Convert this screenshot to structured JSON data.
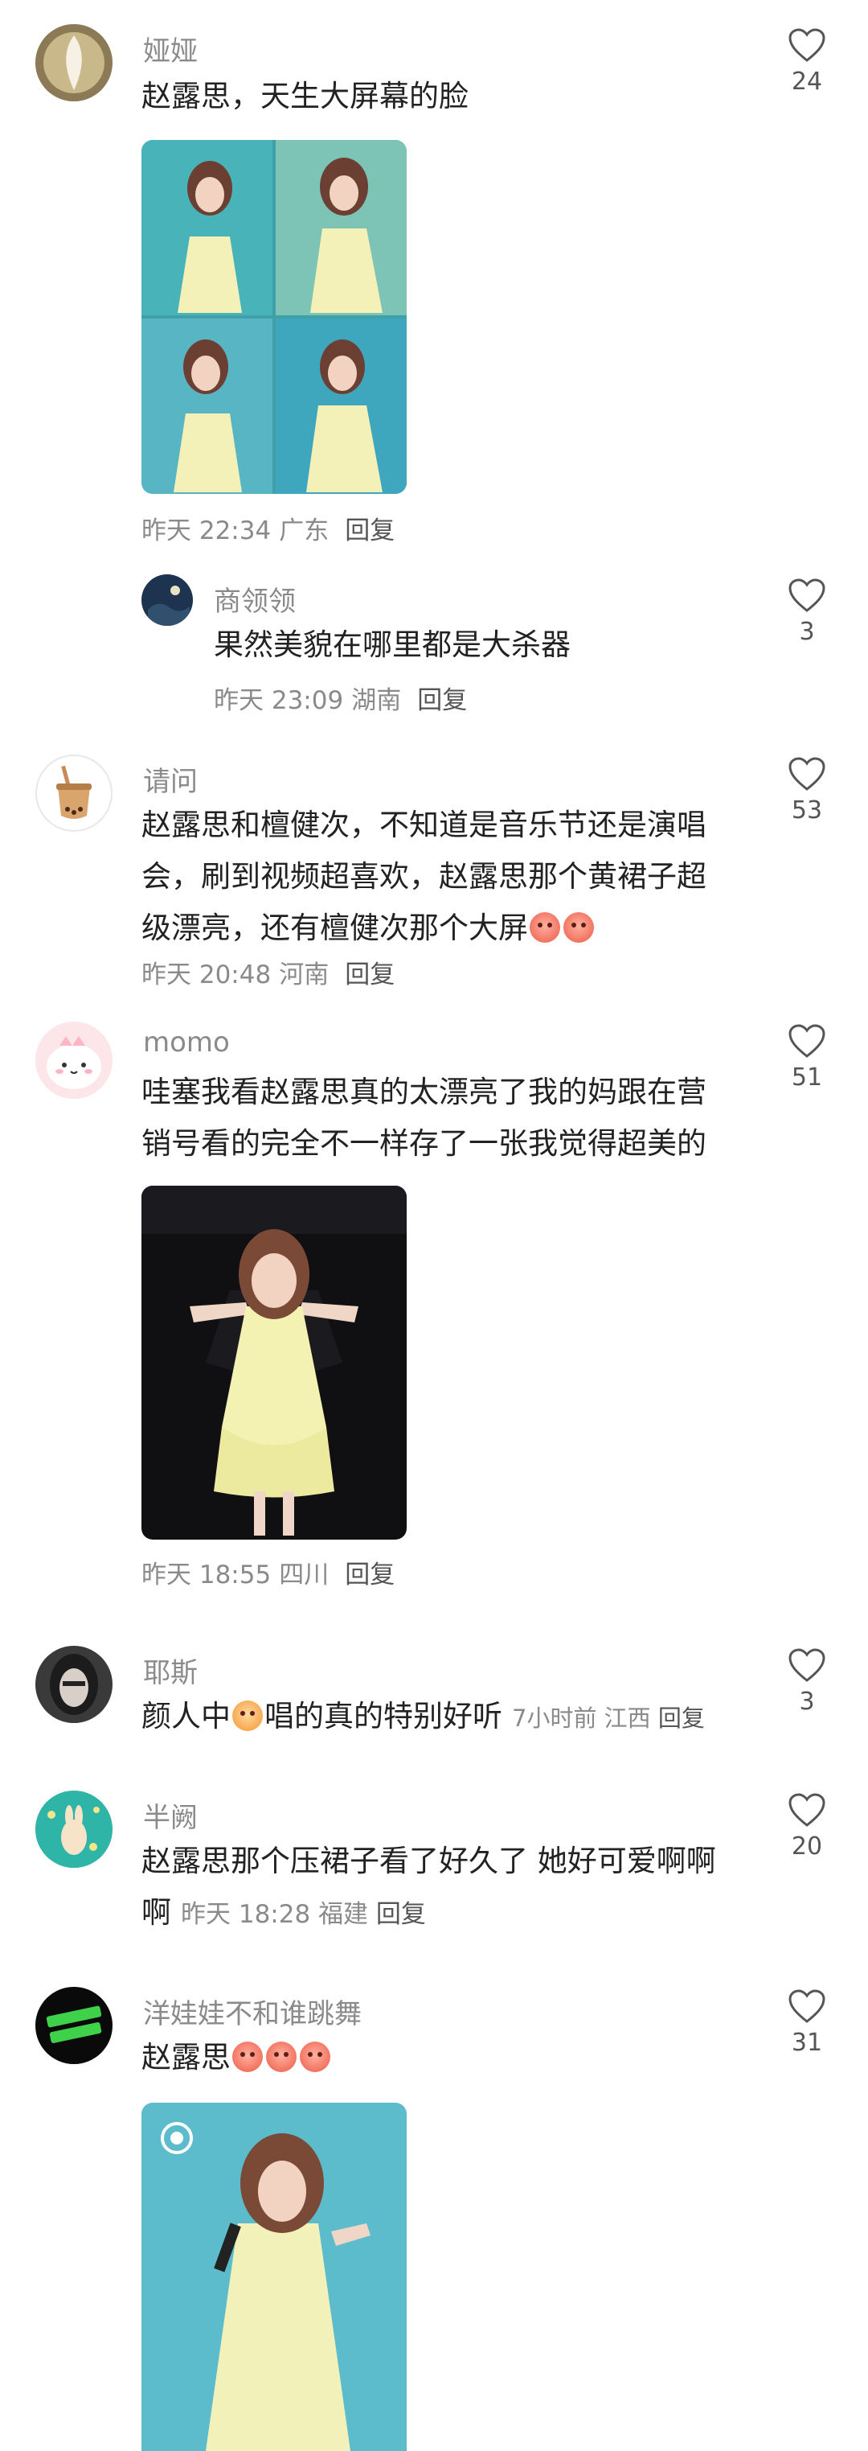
{
  "comments": [
    {
      "username": "娅娅",
      "text": "赵露思，天生大屏幕的脸",
      "time": "昨天 22:34",
      "location": "广东",
      "reply": "回复",
      "likes": "24"
    },
    {
      "username": "商领领",
      "text": "果然美貌在哪里都是大杀器",
      "time": "昨天 23:09",
      "location": "湖南",
      "reply": "回复",
      "likes": "3"
    },
    {
      "username": "请问",
      "text_lines": [
        "赵露思和檀健次，不知道是音乐节还是演唱",
        "会，刷到视频超喜欢，赵露思那个黄裙子超",
        "级漂亮，还有檀健次那个大屏"
      ],
      "time": "昨天 20:48",
      "location": "河南",
      "reply": "回复",
      "likes": "53"
    },
    {
      "username": "momo",
      "text_lines": [
        "哇塞我看赵露思真的太漂亮了我的妈跟在营",
        "销号看的完全不一样存了一张我觉得超美的"
      ],
      "time": "昨天 18:55",
      "location": "四川",
      "reply": "回复",
      "likes": "51"
    },
    {
      "username": "耶斯",
      "text_a": "颜人中",
      "text_b": "唱的真的特别好听",
      "time": "7小时前",
      "location": "江西",
      "reply": "回复",
      "likes": "3"
    },
    {
      "username": "半阙",
      "text_line1": "赵露思那个压裙子看了好久了 她好可爱啊啊",
      "text_line2": "啊",
      "time": "昨天 18:28",
      "location": "福建",
      "reply": "回复",
      "likes": "20"
    },
    {
      "username": "洋娃娃不和谁跳舞",
      "text": "赵露思",
      "likes": "31"
    }
  ],
  "icons": {
    "like": "heart-outline-icon",
    "emoji_tears": "loudly-crying-emoji-icon",
    "emoji_laugh": "grinning-face-emoji-icon"
  },
  "colors": {
    "text": "#222222",
    "meta": "#8a8a8a",
    "background": "#ffffff"
  }
}
